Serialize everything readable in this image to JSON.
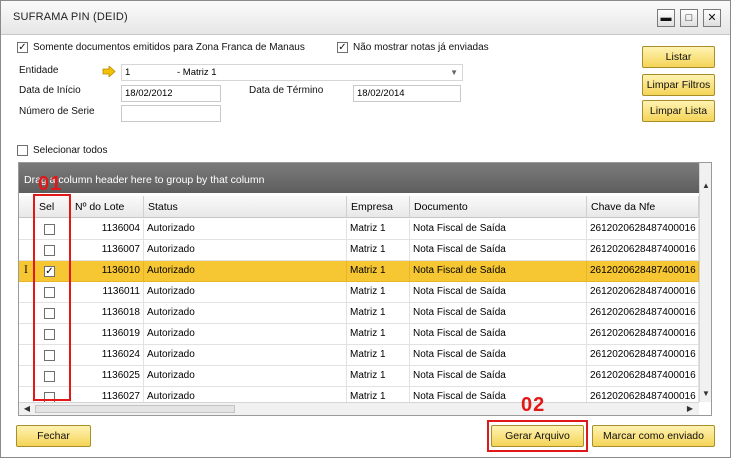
{
  "window": {
    "title": "SUFRAMA PIN (DEID)",
    "minimize_glyph": "▬",
    "maximize_glyph": "□",
    "close_glyph": "✕"
  },
  "filters": {
    "somente_docs": {
      "label": "Somente documentos emitidos para Zona Franca de Manaus",
      "checked": true
    },
    "nao_mostrar": {
      "label": "Não mostrar notas já enviadas",
      "checked": true
    },
    "entidade_label": "Entidade",
    "entidade_code": "1",
    "entidade_name": "- Matriz 1",
    "data_inicio_label": "Data de Início",
    "data_inicio_value": "18/02/2012",
    "data_termino_label": "Data de Término",
    "data_termino_value": "18/02/2014",
    "numero_serie_label": "Número de Serie",
    "numero_serie_value": ""
  },
  "side_buttons": {
    "listar": "Listar",
    "limpar_filtros": "Limpar Filtros",
    "limpar_lista": "Limpar Lista"
  },
  "selecionar_todos": {
    "label": "Selecionar todos",
    "checked": false
  },
  "grid": {
    "group_hint": "Drag a column header here to group by that column",
    "columns": [
      "Sel",
      "Nº do Lote",
      "Status",
      "Empresa",
      "Documento",
      "Chave da Nfe"
    ],
    "rows": [
      {
        "sel": false,
        "lote": "1136004",
        "status": "Autorizado",
        "empresa": "Matriz 1",
        "documento": "Nota Fiscal de Saída",
        "chave": "2612020628487400016"
      },
      {
        "sel": false,
        "lote": "1136007",
        "status": "Autorizado",
        "empresa": "Matriz 1",
        "documento": "Nota Fiscal de Saída",
        "chave": "2612020628487400016"
      },
      {
        "sel": true,
        "lote": "1136010",
        "status": "Autorizado",
        "empresa": "Matriz 1",
        "documento": "Nota Fiscal de Saída",
        "chave": "2612020628487400016"
      },
      {
        "sel": false,
        "lote": "1136011",
        "status": "Autorizado",
        "empresa": "Matriz 1",
        "documento": "Nota Fiscal de Saída",
        "chave": "2612020628487400016"
      },
      {
        "sel": false,
        "lote": "1136018",
        "status": "Autorizado",
        "empresa": "Matriz 1",
        "documento": "Nota Fiscal de Saída",
        "chave": "2612020628487400016"
      },
      {
        "sel": false,
        "lote": "1136019",
        "status": "Autorizado",
        "empresa": "Matriz 1",
        "documento": "Nota Fiscal de Saída",
        "chave": "2612020628487400016"
      },
      {
        "sel": false,
        "lote": "1136024",
        "status": "Autorizado",
        "empresa": "Matriz 1",
        "documento": "Nota Fiscal de Saída",
        "chave": "2612020628487400016"
      },
      {
        "sel": false,
        "lote": "1136025",
        "status": "Autorizado",
        "empresa": "Matriz 1",
        "documento": "Nota Fiscal de Saída",
        "chave": "2612020628487400016"
      },
      {
        "sel": false,
        "lote": "1136027",
        "status": "Autorizado",
        "empresa": "Matriz 1",
        "documento": "Nota Fiscal de Saída",
        "chave": "2612020628487400016"
      }
    ]
  },
  "bottom_buttons": {
    "fechar": "Fechar",
    "gerar_arquivo": "Gerar Arquivo",
    "marcar_enviado": "Marcar como enviado"
  },
  "annotations": {
    "marker_1": "01",
    "marker_2": "02"
  },
  "colors": {
    "selected_row": "#f6c633",
    "button_fill": "#f4d457",
    "annotation_red": "#e01818",
    "group_area": "#6b6b6b"
  },
  "icons": {
    "entidade_link": "yellow-arrow-right-icon",
    "dropdown": "chevron-down-icon",
    "row_cursor": "text-cursor-icon"
  }
}
